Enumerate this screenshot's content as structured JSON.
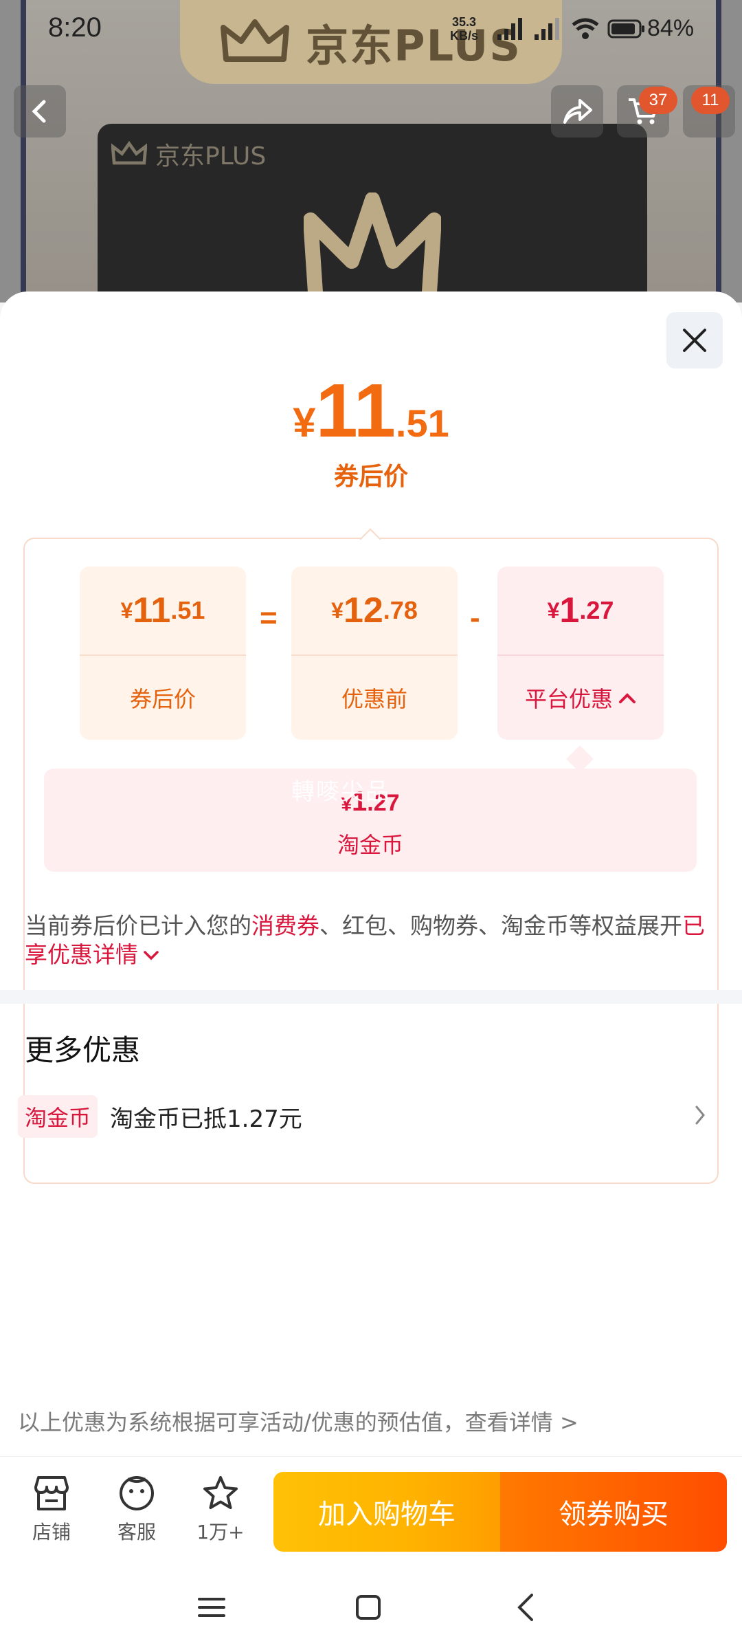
{
  "status_bar": {
    "time": "8:20",
    "net_rate": "35.3",
    "net_unit": "KB/s",
    "battery": "84%"
  },
  "background": {
    "brand": "京东PLUS",
    "card_brand": "京东PLUS",
    "cart_badge": "37",
    "msg_badge": "11"
  },
  "sheet": {
    "final_price": {
      "yen": "¥",
      "int": "11",
      "dec": ".51",
      "label": "券后价"
    },
    "breakdown": {
      "after_coupon": {
        "yen": "¥",
        "int": "11",
        "dec": ".51",
        "label": "券后价"
      },
      "equals": "=",
      "before_discount": {
        "yen": "¥",
        "int": "12",
        "dec": ".78",
        "label": "优惠前"
      },
      "minus": "-",
      "platform": {
        "yen": "¥",
        "int": "1",
        "dec": ".27",
        "label": "平台优惠"
      },
      "coin": {
        "yen": "¥",
        "int": "1",
        "dec": ".27",
        "label": "淘金币",
        "watermark": "轉嘜尖品"
      }
    },
    "note": {
      "prefix": "当前券后价已计入您的",
      "highlight": "消费券",
      "middle": "、红包、购物券、淘金币等权益展开",
      "link": "已享优惠详情"
    },
    "more": {
      "title": "更多优惠",
      "tag": "淘金币",
      "text": "淘金币已抵1.27元"
    },
    "disclaimer": "以上优惠为系统根据可享活动/优惠的预估值，查看详情 >"
  },
  "bottom_bar": {
    "store": "店铺",
    "service": "客服",
    "favorite": "1万+",
    "add_cart": "加入购物车",
    "buy": "领券购买"
  },
  "colors": {
    "orange": "#f26b10",
    "red": "#d9173d",
    "cart_yellow": "#ffb300",
    "buy_orange": "#ff5a00"
  }
}
